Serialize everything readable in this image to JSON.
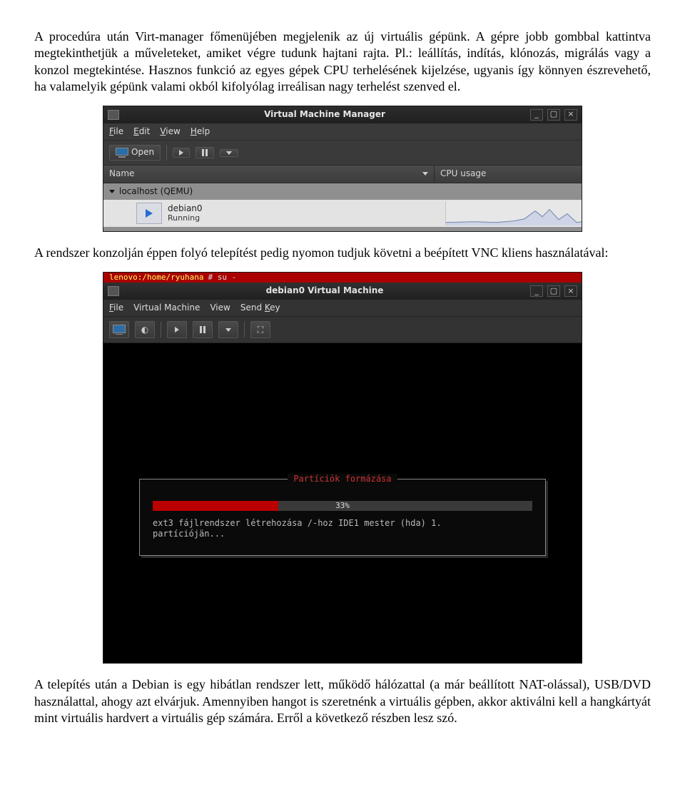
{
  "para1": "A procedúra után Virt-manager főmenüjében megjelenik az új virtuális gépünk. A gépre jobb gombbal kattintva megtekinthetjük a műveleteket, amiket végre tudunk hajtani rajta. Pl.: leállítás, indítás, klónozás, migrálás vagy a konzol megtekintése. Hasznos funkció az egyes gépek CPU terhelésének kijelzése, ugyanis így könnyen észrevehető, ha valamelyik gépünk valami okból kifolyólag irreálisan nagy terhelést szenved el.",
  "para2": "A rendszer konzolján éppen folyó telepítést pedig nyomon tudjuk követni a beépített VNC kliens használatával:",
  "para3": "A telepítés után a Debian is egy hibátlan rendszer lett, működő hálózattal (a már beállított NAT-olással), USB/DVD használattal, ahogy azt elvárjuk. Amennyiben hangot is szeretnénk a virtuális gépben, akkor aktiválni kell a hangkártyát mint virtuális hardvert a virtuális gép számára. Erről a következő részben lesz szó.",
  "vmm": {
    "title": "Virtual Machine Manager",
    "menu": {
      "file": "File",
      "edit": "Edit",
      "view": "View",
      "help": "Help"
    },
    "toolbar": {
      "open": "Open"
    },
    "headers": {
      "name": "Name",
      "cpu": "CPU usage"
    },
    "host": "localhost (QEMU)",
    "vm": {
      "name": "debian0",
      "state": "Running"
    }
  },
  "vm": {
    "title": "debian0 Virtual Machine",
    "menu": {
      "file": "File",
      "virtual_machine": "Virtual Machine",
      "view": "View",
      "send_key": "Send Key"
    },
    "prompt": {
      "userhost": "lenovo:/home/ryuhana",
      "cmd": "# su -"
    },
    "dialog": {
      "title": "Partíciók formázása",
      "percent": "33%",
      "line1": "ext3 fájlrendszer létrehozása /-hoz IDE1 mester (hda) 1.",
      "line2": "partíciójän..."
    }
  }
}
